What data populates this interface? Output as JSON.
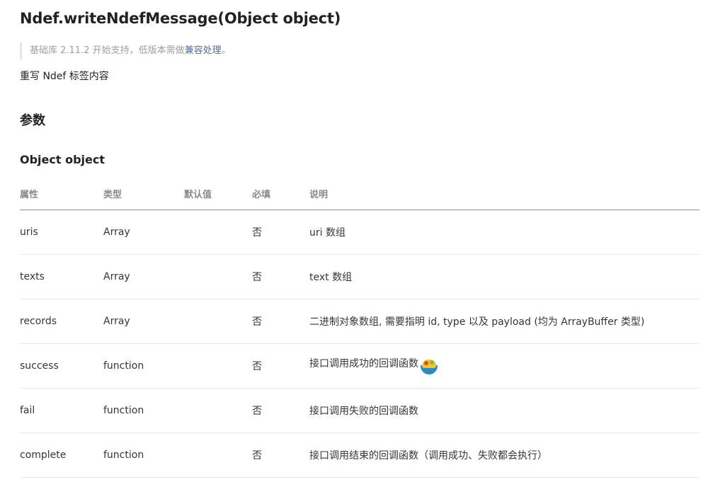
{
  "title": "Ndef.writeNdefMessage(Object object)",
  "note": {
    "prefix": "基础库 2.11.2 开始支持，低版本需做",
    "link": "兼容处理",
    "suffix": "。"
  },
  "description": "重写 Ndef 标签内容",
  "params_heading": "参数",
  "object_heading": "Object object",
  "table": {
    "headers": {
      "property": "属性",
      "type": "类型",
      "default": "默认值",
      "required": "必填",
      "explanation": "说明"
    },
    "rows": [
      {
        "property": "uris",
        "type": "Array",
        "default": "",
        "required": "否",
        "explanation": "uri 数组"
      },
      {
        "property": "texts",
        "type": "Array",
        "default": "",
        "required": "否",
        "explanation": "text 数组"
      },
      {
        "property": "records",
        "type": "Array",
        "default": "",
        "required": "否",
        "explanation": "二进制对象数组, 需要指明 id, type 以及 payload (均为 ArrayBuffer 类型)"
      },
      {
        "property": "success",
        "type": "function",
        "default": "",
        "required": "否",
        "explanation": "接口调用成功的回调函数"
      },
      {
        "property": "fail",
        "type": "function",
        "default": "",
        "required": "否",
        "explanation": "接口调用失败的回调函数"
      },
      {
        "property": "complete",
        "type": "function",
        "default": "",
        "required": "否",
        "explanation": "接口调用结束的回调函数（调用成功、失败都会执行）"
      }
    ]
  },
  "colors": {
    "link": "#576b95",
    "note_text": "#9e9e9e",
    "header_text": "#8a8a8a"
  },
  "icons": {
    "overlay": "food-bowl-emoji-icon"
  }
}
